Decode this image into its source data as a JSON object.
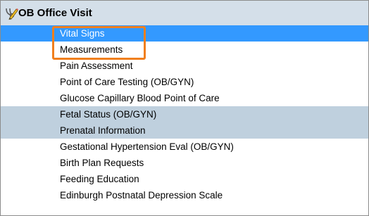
{
  "header": {
    "title": "OB Office Visit",
    "icon": "stethoscope-pencil-icon"
  },
  "rows": [
    {
      "label": "Vital Signs",
      "state": "selected"
    },
    {
      "label": "Measurements",
      "state": "normal"
    },
    {
      "label": "Pain Assessment",
      "state": "normal"
    },
    {
      "label": "Point of Care Testing (OB/GYN)",
      "state": "normal"
    },
    {
      "label": "Glucose Capillary Blood Point of Care",
      "state": "normal"
    },
    {
      "label": "Fetal Status (OB/GYN)",
      "state": "group"
    },
    {
      "label": "Prenatal Information",
      "state": "group"
    },
    {
      "label": "Gestational Hypertension Eval (OB/GYN)",
      "state": "normal"
    },
    {
      "label": "Birth Plan Requests",
      "state": "normal"
    },
    {
      "label": "Feeding Education",
      "state": "normal"
    },
    {
      "label": "Edinburgh Postnatal Depression Scale",
      "state": "normal"
    }
  ],
  "colors": {
    "selected": "#3399ff",
    "group": "#bfd0de",
    "header": "#d4dfe9",
    "highlight": "#f07f1e"
  }
}
